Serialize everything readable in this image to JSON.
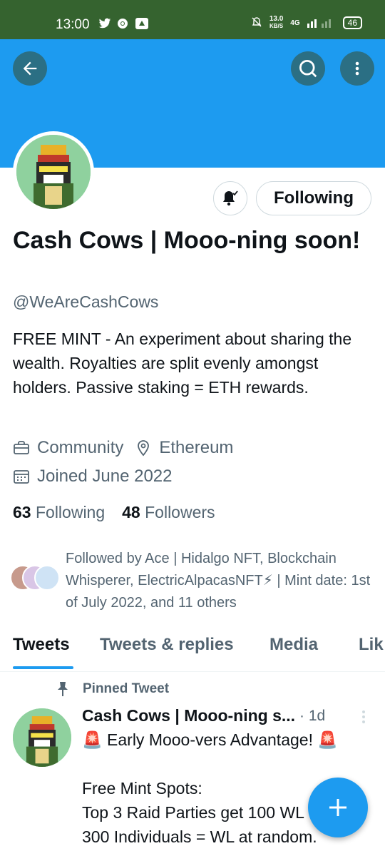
{
  "status_bar": {
    "time": "13:00",
    "left_icons": [
      "twitter-icon",
      "chrome-icon",
      "drive-icon"
    ],
    "net_speed": "13.0",
    "net_speed_unit": "KB/S",
    "net_type": "4G",
    "battery": "46"
  },
  "header": {
    "back_icon": "arrow-left-icon",
    "search_icon": "search-icon",
    "more_icon": "more-vertical-icon",
    "banner_color": "#1d9bf0"
  },
  "profile": {
    "display_name": "Cash Cows | Mooo-ning soon!",
    "handle": "@WeAreCashCows",
    "bio": "FREE MINT - An experiment about sharing the wealth. Royalties are split evenly amongst holders. Passive staking = ETH rewards.",
    "category": "Community",
    "location": "Ethereum",
    "joined": "Joined June 2022",
    "following_count": "63",
    "following_label": "Following",
    "followers_count": "48",
    "followers_label": "Followers",
    "followed_by": "Followed by Ace | Hidalgo NFT, Blockchain Whisperer, ElectricAlpacasNFT⚡ | Mint date: 1st of July 2022, and 11 others",
    "following_button": "Following"
  },
  "tabs": [
    {
      "label": "Tweets",
      "active": true
    },
    {
      "label": "Tweets & replies",
      "active": false
    },
    {
      "label": "Media",
      "active": false
    },
    {
      "label": "Lik",
      "active": false
    }
  ],
  "pinned_tweet": {
    "pinned_label": "Pinned Tweet",
    "author": "Cash Cows | Mooo-ning s...",
    "time": "· 1d",
    "body": "🚨 Early Mooo-vers Advantage! 🚨\n\nFree Mint Spots:\nTop 3 Raid Parties get 100 WL\n300 Individuals = WL at random."
  },
  "colors": {
    "accent": "#1d9bf0",
    "status_bar": "#35632f",
    "secondary_text": "#536471"
  }
}
